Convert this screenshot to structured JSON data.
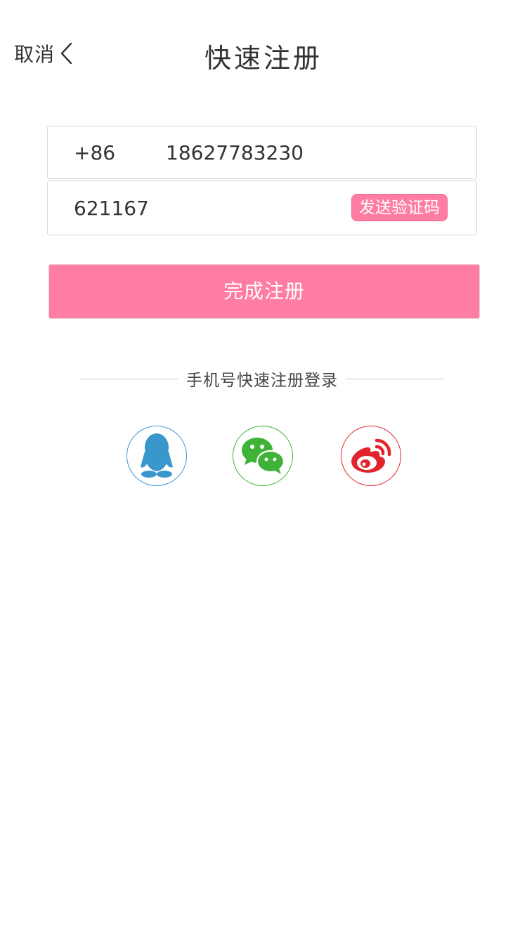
{
  "header": {
    "cancel_label": "取消",
    "title": "快速注册"
  },
  "form": {
    "country_code": "+86",
    "phone_value": "18627783230",
    "code_value": "621167",
    "send_code_label": "发送验证码",
    "submit_label": "完成注册"
  },
  "divider": {
    "text": "手机号快速注册登录"
  },
  "social": [
    {
      "name": "qq",
      "icon": "qq-icon",
      "color": "#3a97cc"
    },
    {
      "name": "wechat",
      "icon": "wechat-icon",
      "color": "#3fb338"
    },
    {
      "name": "weibo",
      "icon": "weibo-icon",
      "color": "#e2232e"
    }
  ],
  "colors": {
    "accent": "#ff7ca3",
    "border": "#d8d8d8",
    "text": "#333333"
  }
}
